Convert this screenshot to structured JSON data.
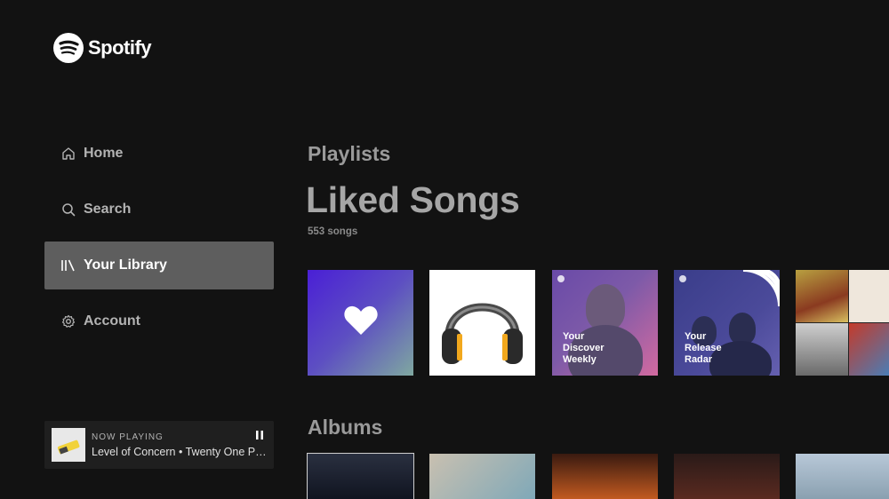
{
  "app": {
    "name": "Spotify"
  },
  "nav": {
    "items": [
      {
        "label": "Home",
        "icon": "home-icon"
      },
      {
        "label": "Search",
        "icon": "search-icon"
      },
      {
        "label": "Your Library",
        "icon": "library-icon",
        "active": true
      },
      {
        "label": "Account",
        "icon": "gear-icon"
      }
    ]
  },
  "now_playing": {
    "label": "NOW PLAYING",
    "track": "Level of Concern • Twenty One Pilots",
    "control_icon": "pause-icon"
  },
  "main": {
    "playlists_heading": "Playlists",
    "liked_title": "Liked Songs",
    "liked_count": "553 songs",
    "playlist_tiles": [
      {
        "type": "liked-songs",
        "icon": "heart-icon"
      },
      {
        "type": "headphones-cover",
        "icon": "headphones-icon"
      },
      {
        "type": "discover-weekly",
        "caption": "Your\nDiscover\nWeekly"
      },
      {
        "type": "release-radar",
        "caption": "Your\nRelease\nRadar"
      },
      {
        "type": "mosaic"
      }
    ],
    "albums_heading": "Albums",
    "album_count_visible": 5
  },
  "colors": {
    "background": "#121212",
    "sidebar_active": "#5e5e5e",
    "now_playing_bg": "#1f1f1f"
  }
}
